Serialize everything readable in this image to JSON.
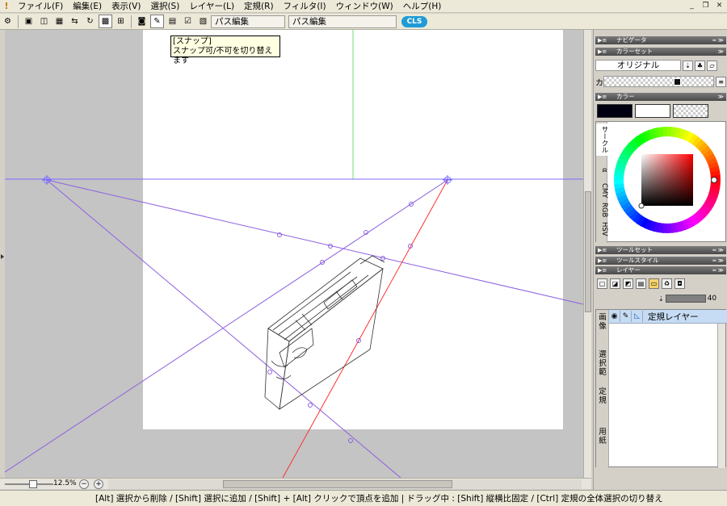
{
  "menubar": {
    "items": [
      "ファイル(F)",
      "編集(E)",
      "表示(V)",
      "選択(S)",
      "レイヤー(L)",
      "定規(R)",
      "フィルタ(I)",
      "ウィンドウ(W)",
      "ヘルプ(H)"
    ]
  },
  "toolbar": {
    "field1": "パス編集",
    "field2": "パス編集",
    "logo": "CLS"
  },
  "tooltip": {
    "title": "[スナップ]",
    "text": "スナップ可/不可を切り替えます"
  },
  "zoom": {
    "label": "12.5%"
  },
  "statusbar": {
    "text": "[Alt] 選択から削除 / [Shift] 選択に追加 / [Shift] + [Alt] クリックで頂点を追加 | ドラッグ中 : [Shift] 縦横比固定 / [Ctrl] 定規の全体選択の切り替え"
  },
  "panels": {
    "navigator": "ナビゲータ",
    "colorset": "カラーセット",
    "colorset_name": "オリジナル",
    "colorset_row_label": "カ",
    "color": "カラー",
    "color_modes": [
      "サークル",
      "α",
      "CMY",
      "RGB",
      "HSV"
    ],
    "toolset": "ツールセット",
    "toolstyle": "ツールスタイル",
    "layer": "レイヤー",
    "opacity": "40",
    "layer_name": "定規レイヤー",
    "layer_side_tabs": [
      "画像",
      "選択範",
      "定規",
      "用紙"
    ]
  },
  "colors": {
    "main": "#000010",
    "sub": "#ffffff",
    "ruler": "#7b6cff",
    "vanishing_red": "#ff2020"
  }
}
